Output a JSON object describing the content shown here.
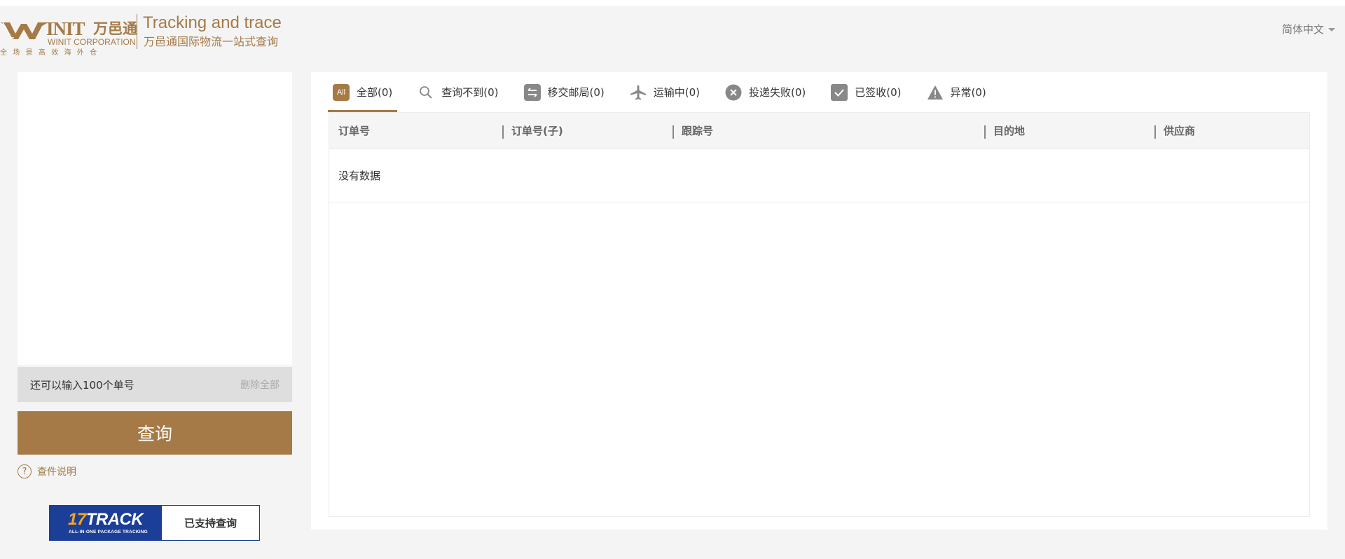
{
  "header": {
    "brand": "INIT",
    "brand_cn": "万邑通",
    "corp": "WINIT CORPORATION",
    "slogan": "全场景高效海外仓",
    "title": "Tracking and trace",
    "subtitle": "万邑通国际物流一站式查询",
    "language": "简体中文"
  },
  "left": {
    "remaining_text": "还可以输入100个单号",
    "clear_all": "删除全部",
    "query_button": "查询",
    "help_icon_glyph": "?",
    "help_text": "查件说明",
    "partner": {
      "logo_number": "17",
      "logo_text": "TRACK",
      "logo_tagline": "ALL-IN-ONE PACKAGE TRACKING",
      "label": "已支持查询"
    }
  },
  "tabs": [
    {
      "label": "全部(0)",
      "icon": "all-icon",
      "icon_text": "All",
      "active": true
    },
    {
      "label": "查询不到(0)",
      "icon": "search-icon",
      "active": false
    },
    {
      "label": "移交邮局(0)",
      "icon": "transfer-icon",
      "active": false
    },
    {
      "label": "运输中(0)",
      "icon": "airplane-icon",
      "active": false
    },
    {
      "label": "投递失败(0)",
      "icon": "failed-icon",
      "active": false
    },
    {
      "label": "已签收(0)",
      "icon": "check-icon",
      "active": false
    },
    {
      "label": "异常(0)",
      "icon": "warning-icon",
      "active": false
    }
  ],
  "table": {
    "columns": [
      "订单号",
      "订单号(子)",
      "跟踪号",
      "目的地",
      "供应商"
    ],
    "empty_text": "没有数据"
  },
  "colors": {
    "brand": "#a57a47",
    "partner_blue": "#1b3f98",
    "icon_gray": "#888888"
  }
}
